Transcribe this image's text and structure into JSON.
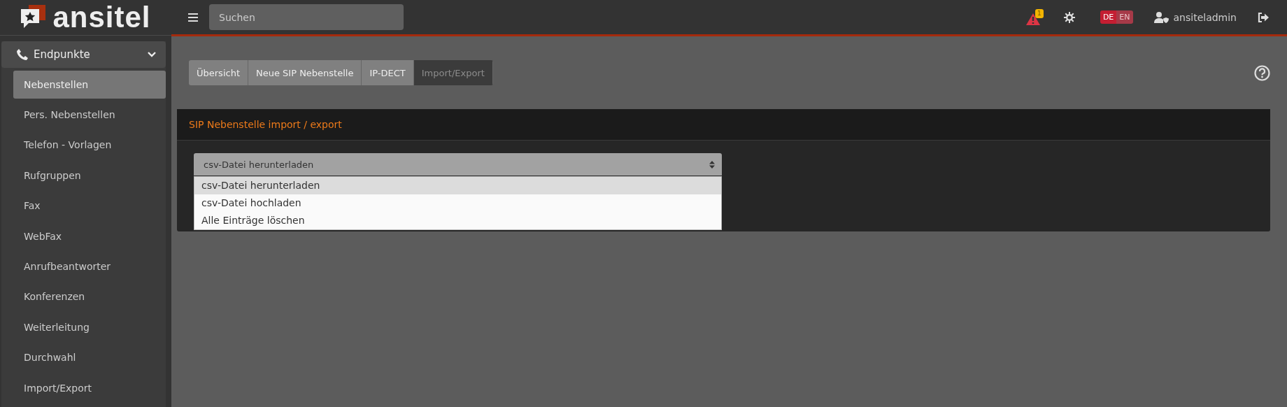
{
  "brand": {
    "name": "ansitel"
  },
  "topbar": {
    "search": {
      "placeholder": "Suchen"
    },
    "alerts": {
      "count": "1"
    },
    "languages": [
      {
        "label": "DE",
        "selected": true
      },
      {
        "label": "EN",
        "selected": false
      }
    ],
    "user": "ansiteladmin"
  },
  "sidebar": {
    "group": {
      "label": "Endpunkte",
      "expanded": true
    },
    "items": [
      {
        "label": "Nebenstellen",
        "selected": true
      },
      {
        "label": "Pers. Nebenstellen",
        "selected": false
      },
      {
        "label": "Telefon - Vorlagen",
        "selected": false
      },
      {
        "label": "Rufgruppen",
        "selected": false
      },
      {
        "label": "Fax",
        "selected": false
      },
      {
        "label": "WebFax",
        "selected": false
      },
      {
        "label": "Anrufbeantworter",
        "selected": false
      },
      {
        "label": "Konferenzen",
        "selected": false
      },
      {
        "label": "Weiterleitung",
        "selected": false
      },
      {
        "label": "Durchwahl",
        "selected": false
      },
      {
        "label": "Import/Export",
        "selected": false
      }
    ]
  },
  "tabs": [
    {
      "label": "Übersicht",
      "selected": false
    },
    {
      "label": "Neue SIP Nebenstelle",
      "selected": false
    },
    {
      "label": "IP-DECT",
      "selected": false
    },
    {
      "label": "Import/Export",
      "selected": true
    }
  ],
  "panel": {
    "title": "SIP Nebenstelle import / export",
    "select": {
      "value": "csv-Datei herunterladen",
      "expanded": true,
      "options": [
        {
          "label": "csv-Datei herunterladen",
          "selected": true
        },
        {
          "label": "csv-Datei hochladen",
          "selected": false
        },
        {
          "label": "Alle Einträge löschen",
          "selected": false
        }
      ]
    }
  }
}
